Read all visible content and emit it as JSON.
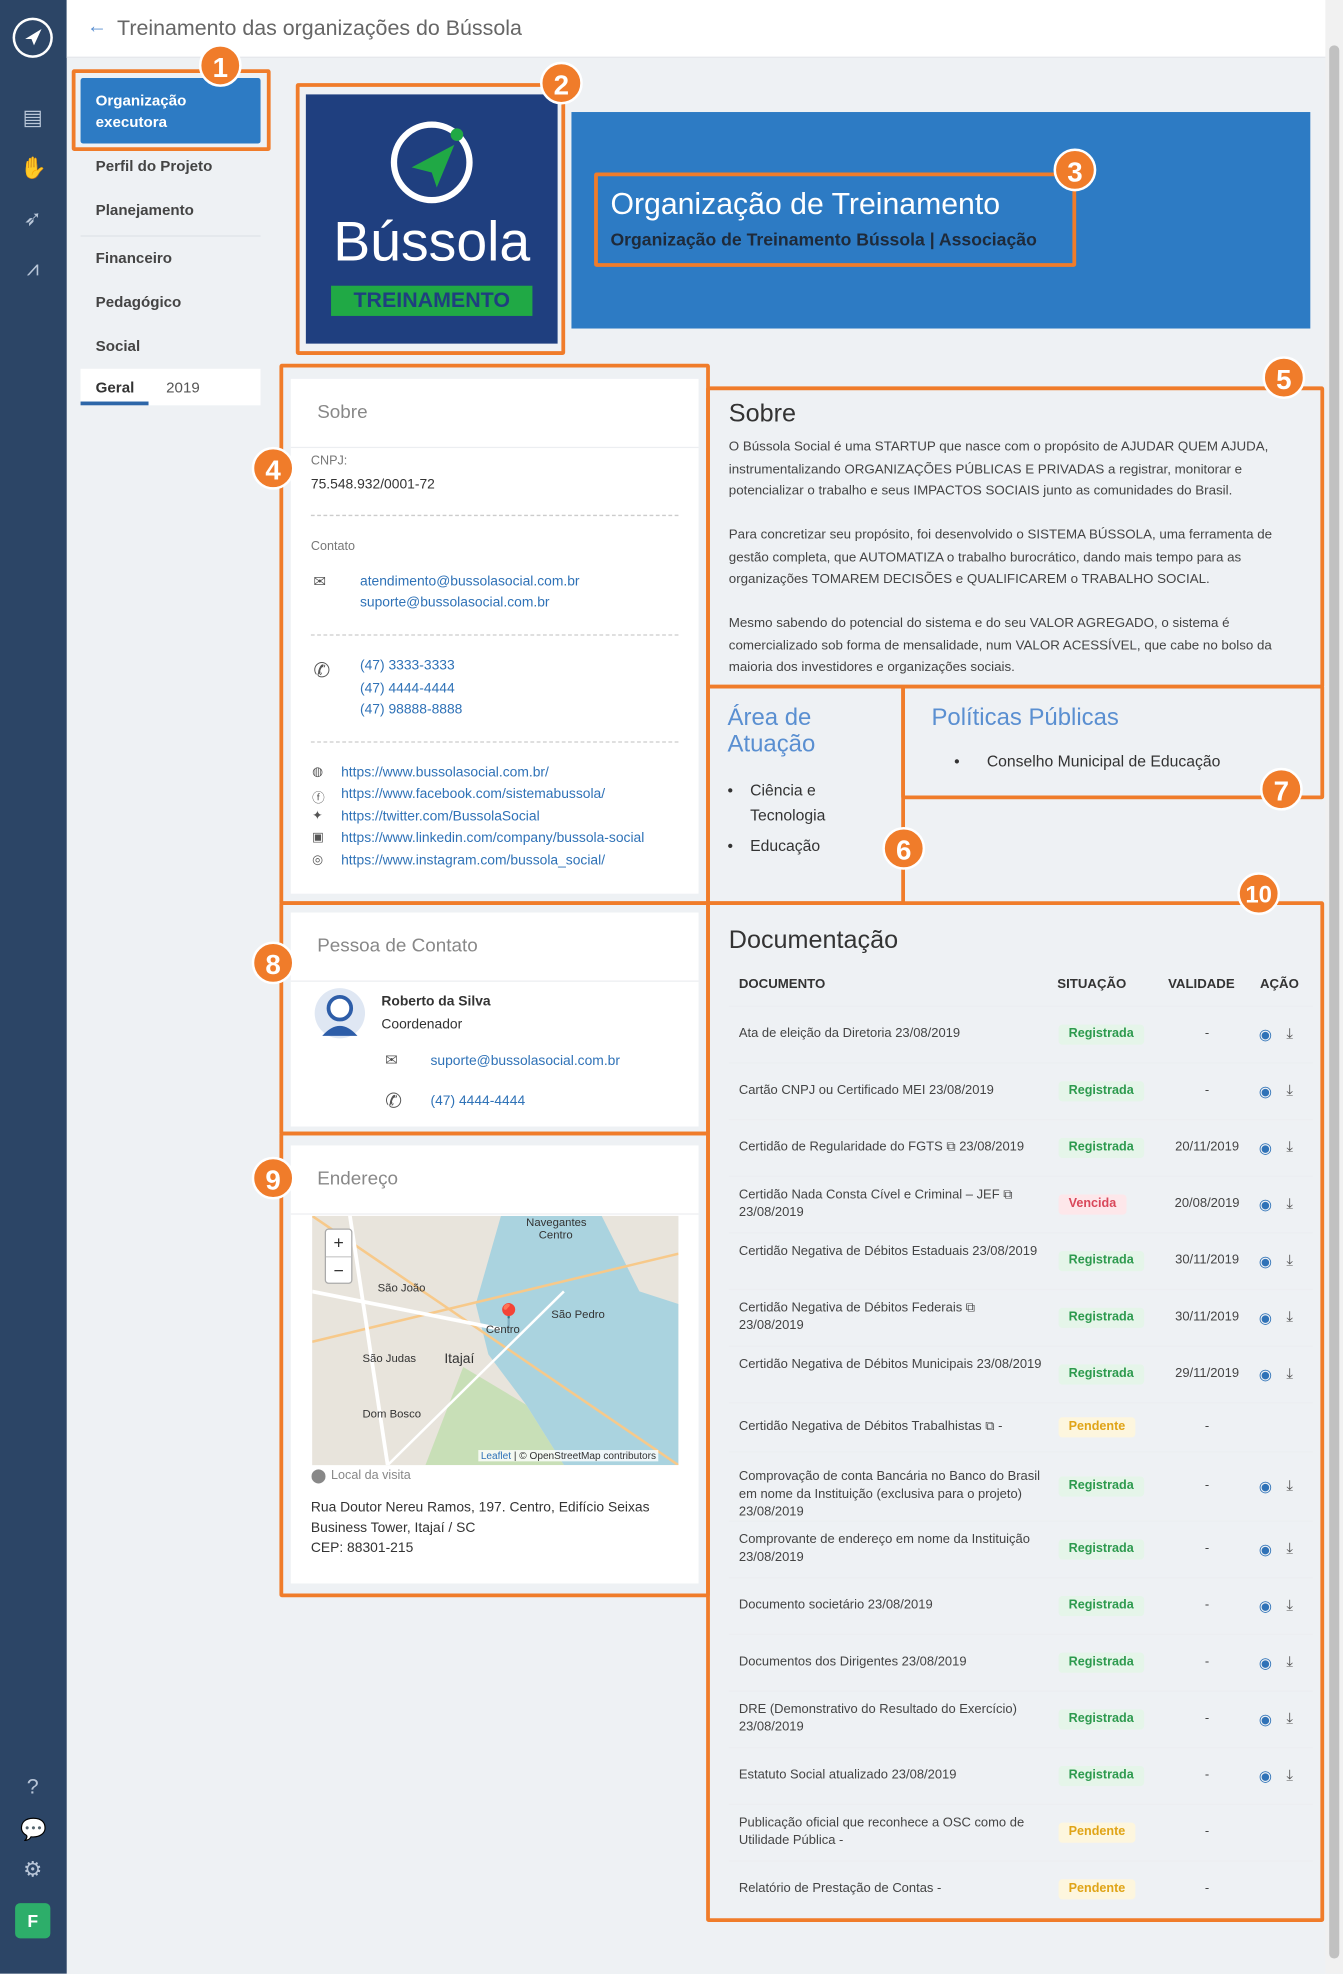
{
  "topbar": {
    "title": "Treinamento das organizações do Bússola"
  },
  "nav": {
    "active": "Organização executora",
    "items": [
      "Perfil do Projeto",
      "Planejamento",
      "Financeiro",
      "Pedagógico",
      "Social"
    ],
    "tabs": [
      "Geral",
      "2019"
    ]
  },
  "banner": {
    "logo_word": "Bússola",
    "logo_tag": "TREINAMENTO",
    "org_name": "Organização de Treinamento",
    "org_sub": "Organização de Treinamento Bússola | Associação"
  },
  "sobre_card": {
    "title": "Sobre",
    "cnpj_label": "CNPJ:",
    "cnpj": "75.548.932/0001-72",
    "contato_label": "Contato",
    "emails": [
      "atendimento@bussolasocial.com.br",
      "suporte@bussolasocial.com.br"
    ],
    "phones": [
      "(47) 3333-3333",
      "(47) 4444-4444",
      "(47) 98888-8888"
    ],
    "links": [
      "https://www.bussolasocial.com.br/",
      "https://www.facebook.com/sistemabussola/",
      "https://twitter.com/BussolaSocial",
      "https://www.linkedin.com/company/bussola-social",
      "https://www.instagram.com/bussola_social/"
    ]
  },
  "about": {
    "title": "Sobre",
    "p1": "O Bússola Social é uma STARTUP que nasce com o propósito de AJUDAR QUEM AJUDA, instrumentalizando ORGANIZAÇÕES PÚBLICAS E PRIVADAS a registrar, monitorar e potencializar o trabalho e seus IMPACTOS SOCIAIS junto as comunidades do Brasil.",
    "p2": "Para concretizar seu propósito, foi desenvolvido o SISTEMA BÚSSOLA, uma ferramenta de gestão completa, que AUTOMATIZA o trabalho burocrático, dando mais tempo para as organizações TOMAREM DECISÕES e QUALIFICAREM o TRABALHO SOCIAL.",
    "p3": "Mesmo sabendo do potencial do sistema e do seu VALOR AGREGADO, o sistema é comercializado sob forma de mensalidade, num VALOR ACESSÍVEL, que cabe no bolso da maioria dos investidores e organizações sociais."
  },
  "area": {
    "title": "Área de Atuação",
    "items": [
      "Ciência e Tecnologia",
      "Educação"
    ]
  },
  "politicas": {
    "title": "Políticas Públicas",
    "items": [
      "Conselho Municipal de Educação"
    ]
  },
  "contato": {
    "title": "Pessoa de Contato",
    "name": "Roberto da Silva",
    "role": "Coordenador",
    "email": "suporte@bussolasocial.com.br",
    "phone": "(47) 4444-4444"
  },
  "endereco": {
    "title": "Endereço",
    "visit": "Local da visita",
    "addr1": "Rua Doutor Nereu Ramos, 197. Centro, Edifício Seixas",
    "addr2": "Business Tower, Itajaí / SC",
    "cep": "CEP: 88301-215",
    "map_labels": [
      "Centro",
      "São João",
      "São Pedro",
      "Centro",
      "São Judas",
      "Itajaí",
      "Dom Bosco",
      "Navegantes",
      "Leaflet",
      "© OpenStreetMap contributors"
    ]
  },
  "documentacao": {
    "title": "Documentação",
    "headers": [
      "DOCUMENTO",
      "SITUAÇÃO",
      "VALIDADE",
      "AÇÃO"
    ],
    "rows": [
      {
        "name": "Ata de eleição da Diretoria 23/08/2019",
        "status": "Registrada",
        "validade": "-"
      },
      {
        "name": "Cartão CNPJ ou Certificado MEI 23/08/2019",
        "status": "Registrada",
        "validade": "-"
      },
      {
        "name": "Certidão de Regularidade do FGTS ⧉ 23/08/2019",
        "status": "Registrada",
        "validade": "20/11/2019"
      },
      {
        "name": "Certidão Nada Consta Cível e Criminal – JEF ⧉ 23/08/2019",
        "status": "Vencida",
        "validade": "20/08/2019"
      },
      {
        "name": "Certidão Negativa de Débitos Estaduais 23/08/2019",
        "status": "Registrada",
        "validade": "30/11/2019"
      },
      {
        "name": "Certidão Negativa de Débitos Federais ⧉ 23/08/2019",
        "status": "Registrada",
        "validade": "30/11/2019"
      },
      {
        "name": "Certidão Negativa de Débitos Municipais 23/08/2019",
        "status": "Registrada",
        "validade": "29/11/2019"
      },
      {
        "name": "Certidão Negativa de Débitos Trabalhistas ⧉ -",
        "status": "Pendente",
        "validade": "-"
      },
      {
        "name": "Comprovação de conta Bancária no Banco do Brasil em nome da Instituição (exclusiva para o projeto) 23/08/2019",
        "status": "Registrada",
        "validade": "-"
      },
      {
        "name": "Comprovante de endereço em nome da Instituição 23/08/2019",
        "status": "Registrada",
        "validade": "-"
      },
      {
        "name": "Documento societário 23/08/2019",
        "status": "Registrada",
        "validade": "-"
      },
      {
        "name": "Documentos dos Dirigentes 23/08/2019",
        "status": "Registrada",
        "validade": "-"
      },
      {
        "name": "DRE (Demonstrativo do Resultado do Exercício) 23/08/2019",
        "status": "Registrada",
        "validade": "-"
      },
      {
        "name": "Estatuto Social atualizado 23/08/2019",
        "status": "Registrada",
        "validade": "-"
      },
      {
        "name": "Publicação oficial que reconhece a OSC como de Utilidade Pública -",
        "status": "Pendente",
        "validade": "-"
      },
      {
        "name": "Relatório de Prestação de Contas -",
        "status": "Pendente",
        "validade": "-"
      }
    ]
  },
  "markers": [
    "1",
    "2",
    "3",
    "4",
    "5",
    "6",
    "7",
    "8",
    "9",
    "10"
  ],
  "colors": {
    "accent": "#2d7bc4",
    "orange": "#f07c2a",
    "rail": "#2c4566",
    "logo_bg": "#1f3f7f",
    "green": "#20a945"
  },
  "rail_icons": [
    "compass-icon",
    "document-icon",
    "hand-icon",
    "rocket-icon",
    "chart-icon",
    "help-icon",
    "chat-icon",
    "gear-icon"
  ],
  "user_initial": "F"
}
